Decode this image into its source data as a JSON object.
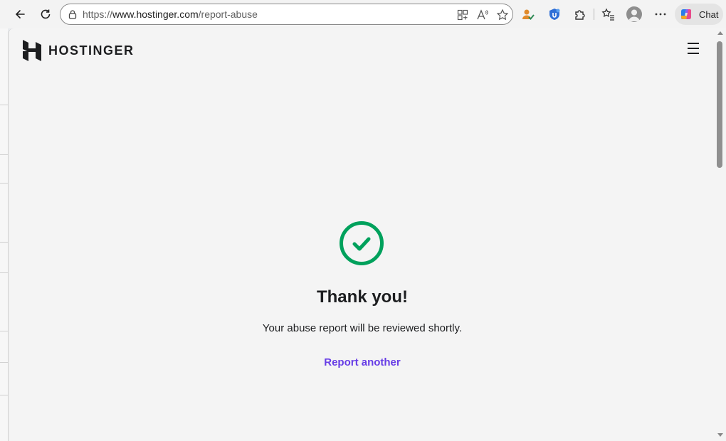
{
  "browser": {
    "url_scheme": "https://",
    "url_host": "www.hostinger.com",
    "url_path": "/report-abuse",
    "chat_label": "Chat",
    "icons": [
      "back-icon",
      "refresh-icon",
      "lock-icon",
      "app-grid-icon",
      "read-aloud-icon",
      "favorite-star-icon",
      "user-check-icon",
      "shield-extension-icon",
      "extensions-icon",
      "favorites-list-icon",
      "profile-avatar-icon",
      "more-options-icon",
      "copilot-icon"
    ]
  },
  "header": {
    "brand_name": "HOSTINGER",
    "icons": [
      "hostinger-logo-icon",
      "hamburger-menu-icon"
    ]
  },
  "confirmation": {
    "title": "Thank you!",
    "message": "Your abuse report will be reviewed shortly.",
    "link_label": "Report another",
    "check_color": "#00a15c",
    "link_color": "#673de6"
  }
}
